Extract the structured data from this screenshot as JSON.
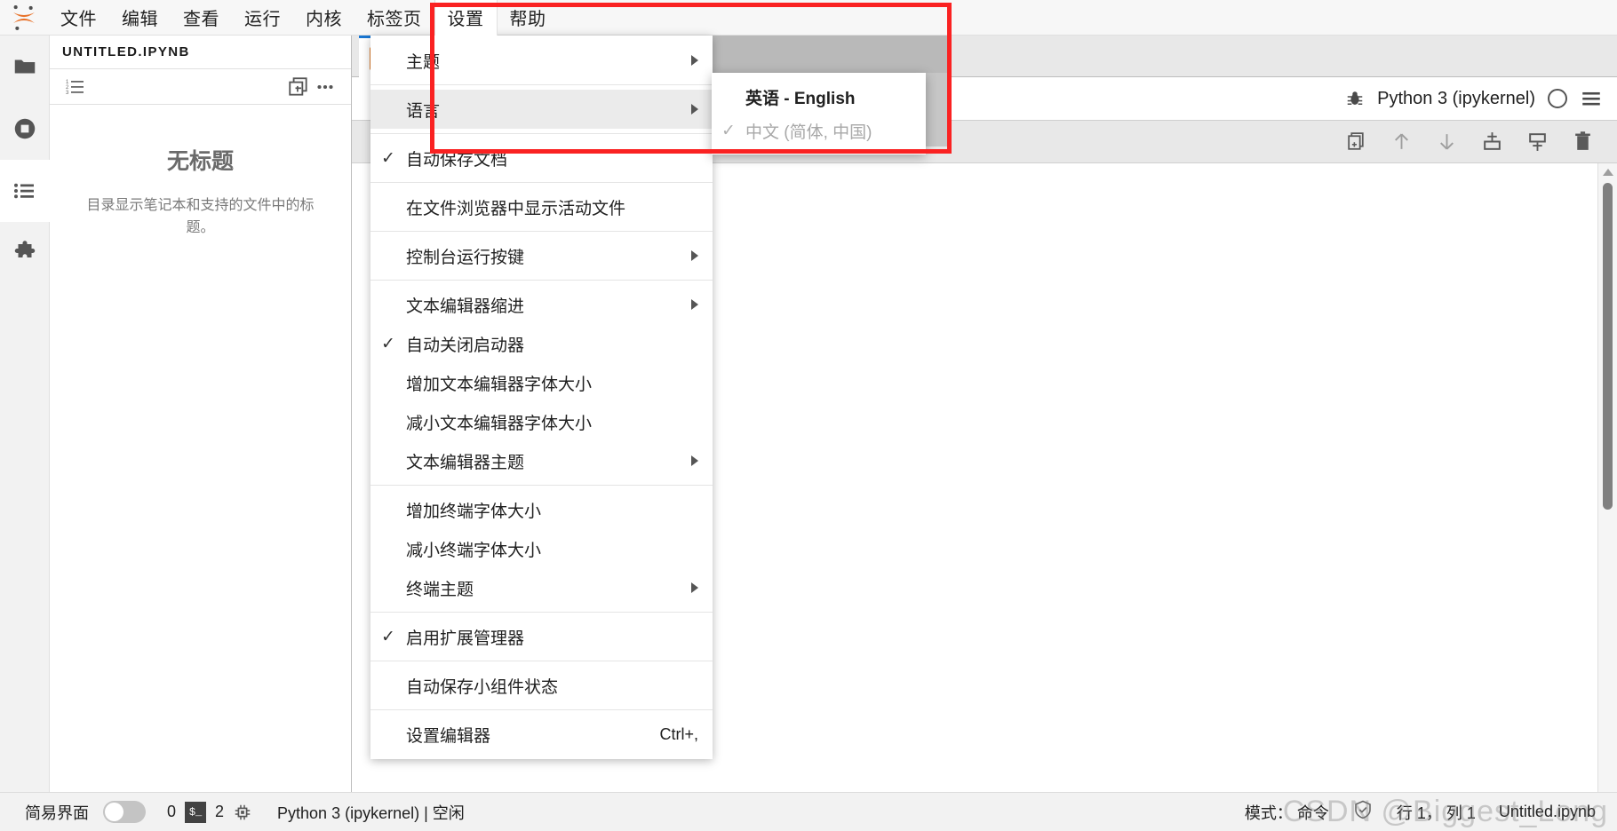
{
  "app": {
    "logo_icon": "jupyter-logo-icon"
  },
  "menubar": {
    "items": [
      {
        "label": "文件",
        "name": "menu-file"
      },
      {
        "label": "编辑",
        "name": "menu-edit"
      },
      {
        "label": "查看",
        "name": "menu-view"
      },
      {
        "label": "运行",
        "name": "menu-run"
      },
      {
        "label": "内核",
        "name": "menu-kernel"
      },
      {
        "label": "标签页",
        "name": "menu-tabs"
      },
      {
        "label": "设置",
        "name": "menu-settings"
      },
      {
        "label": "帮助",
        "name": "menu-help"
      }
    ]
  },
  "activitybar": {
    "items": [
      {
        "icon": "folder-icon",
        "name": "sidebar-item-file-browser",
        "selected": false
      },
      {
        "icon": "stop-circle-icon",
        "name": "sidebar-item-running-terminals",
        "selected": false
      },
      {
        "icon": "list-icon",
        "name": "sidebar-item-table-of-contents",
        "selected": true
      },
      {
        "icon": "puzzle-icon",
        "name": "sidebar-item-extension-manager",
        "selected": false
      }
    ]
  },
  "left_panel": {
    "title": "UNTITLED.IPYNB",
    "toolbar": {
      "numbering_icon": "numbered-list-icon",
      "new_icon": "add-panel-icon",
      "more_icon": "more-horizontal-icon"
    },
    "empty_heading": "无标题",
    "empty_description": "目录显示笔记本和支持的文件中的标题。"
  },
  "notebook": {
    "kernel_name": "Python 3 (ipykernel)",
    "debug_icon": "bug-icon",
    "kernel_status_icon": "kernel-idle-circle-icon",
    "hamburger_icon": "menu-hamburger-icon",
    "toolbar_buttons": [
      {
        "icon": "duplicate-cell-icon",
        "name": "duplicate-cell-button"
      },
      {
        "icon": "move-cell-up-icon",
        "name": "move-cell-up-button"
      },
      {
        "icon": "move-cell-down-icon",
        "name": "move-cell-down-button"
      },
      {
        "icon": "insert-cell-above-icon",
        "name": "insert-cell-above-button"
      },
      {
        "icon": "insert-cell-below-icon",
        "name": "insert-cell-below-button"
      },
      {
        "icon": "delete-cell-icon",
        "name": "delete-cell-button"
      }
    ]
  },
  "settings_menu": {
    "items": [
      {
        "label": "主题",
        "checked": false,
        "submenu": true,
        "shortcut": "",
        "highlighted": false,
        "name": "settings-menu-theme"
      },
      {
        "label": "语言",
        "checked": false,
        "submenu": true,
        "shortcut": "",
        "highlighted": true,
        "name": "settings-menu-language"
      },
      {
        "separator_before": true,
        "label": "自动保存文档",
        "checked": true,
        "submenu": false,
        "shortcut": "",
        "highlighted": false,
        "name": "settings-menu-autosave-documents"
      },
      {
        "separator_before": true,
        "label": "在文件浏览器中显示活动文件",
        "checked": false,
        "submenu": false,
        "shortcut": "",
        "highlighted": false,
        "name": "settings-menu-show-active-file-in-browser"
      },
      {
        "separator_before": true,
        "label": "控制台运行按键",
        "checked": false,
        "submenu": true,
        "shortcut": "",
        "highlighted": false,
        "name": "settings-menu-console-run-keystroke"
      },
      {
        "separator_before": true,
        "label": "文本编辑器缩进",
        "checked": false,
        "submenu": true,
        "shortcut": "",
        "highlighted": false,
        "name": "settings-menu-text-editor-indentation"
      },
      {
        "label": "自动关闭启动器",
        "checked": true,
        "submenu": false,
        "shortcut": "",
        "highlighted": false,
        "name": "settings-menu-auto-close-launcher"
      },
      {
        "label": "增加文本编辑器字体大小",
        "checked": false,
        "submenu": false,
        "shortcut": "",
        "highlighted": false,
        "name": "settings-menu-increase-editor-font-size"
      },
      {
        "label": "减小文本编辑器字体大小",
        "checked": false,
        "submenu": false,
        "shortcut": "",
        "highlighted": false,
        "name": "settings-menu-decrease-editor-font-size"
      },
      {
        "label": "文本编辑器主题",
        "checked": false,
        "submenu": true,
        "shortcut": "",
        "highlighted": false,
        "name": "settings-menu-text-editor-theme"
      },
      {
        "separator_before": true,
        "label": "增加终端字体大小",
        "checked": false,
        "submenu": false,
        "shortcut": "",
        "highlighted": false,
        "name": "settings-menu-increase-terminal-font-size"
      },
      {
        "label": "减小终端字体大小",
        "checked": false,
        "submenu": false,
        "shortcut": "",
        "highlighted": false,
        "name": "settings-menu-decrease-terminal-font-size"
      },
      {
        "label": "终端主题",
        "checked": false,
        "submenu": true,
        "shortcut": "",
        "highlighted": false,
        "name": "settings-menu-terminal-theme"
      },
      {
        "separator_before": true,
        "label": "启用扩展管理器",
        "checked": true,
        "submenu": false,
        "shortcut": "",
        "highlighted": false,
        "name": "settings-menu-enable-extension-manager"
      },
      {
        "separator_before": true,
        "label": "自动保存小组件状态",
        "checked": false,
        "submenu": false,
        "shortcut": "",
        "highlighted": false,
        "name": "settings-menu-auto-save-widget-state"
      },
      {
        "separator_before": true,
        "label": "设置编辑器",
        "checked": false,
        "submenu": false,
        "shortcut": "Ctrl+,",
        "highlighted": false,
        "name": "settings-menu-settings-editor"
      }
    ]
  },
  "language_submenu": {
    "items": [
      {
        "label": "英语 - English",
        "checked": false,
        "disabled": false,
        "name": "language-option-english"
      },
      {
        "label": "中文 (简体, 中国)",
        "checked": true,
        "disabled": true,
        "name": "language-option-chinese-simplified"
      }
    ]
  },
  "statusbar": {
    "simple_mode_label": "简易界面",
    "simple_mode_on": false,
    "terminal_count": "0",
    "terminal_icon": "terminal-icon",
    "kernel_count": "2",
    "kernel_icon": "cpu-chip-icon",
    "kernel_status": "Python 3 (ipykernel) | 空闲",
    "mode_label": "模式： 命令",
    "trust_icon": "shield-check-icon",
    "position": "行 1， 列 1",
    "filename": "Untitled.ipynb"
  },
  "annotation": {
    "box_color": "#fa2222"
  },
  "watermark": {
    "text": "CSDN @Biggest_Long"
  }
}
